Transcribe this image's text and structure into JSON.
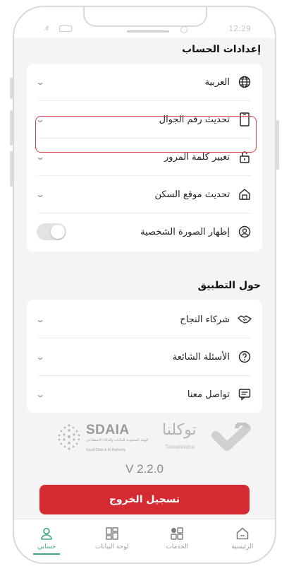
{
  "status_bar": {
    "time": "12:29"
  },
  "account_settings": {
    "title": "إعدادات الحساب",
    "items": [
      {
        "label": "العربية",
        "icon": "globe-icon"
      },
      {
        "label": "تحديث رقم الجوال",
        "icon": "mobile-phone-icon"
      },
      {
        "label": "تغيير كلمة المرور",
        "icon": "lock-icon"
      },
      {
        "label": "تحديث موقع السكن",
        "icon": "home-icon"
      },
      {
        "label": "إظهار الصورة الشخصية",
        "icon": "user-circle-icon",
        "toggle_on": false
      }
    ]
  },
  "about_app": {
    "title": "حول التطبيق",
    "items": [
      {
        "label": "شركاء النجاح",
        "icon": "handshake-icon"
      },
      {
        "label": "الأسئلة الشائعة",
        "icon": "question-icon"
      },
      {
        "label": "تواصل معنا",
        "icon": "chat-icon"
      }
    ]
  },
  "logos": {
    "sdaia_name": "SDAIA",
    "sdaia_ar": "الهيئة السعودية للبيانات والذكاء الاصطناعي",
    "sdaia_en": "Saudi Data & AI Authority",
    "tawakkalna_ar": "توكلنا",
    "tawakkalna_en": "Tawakkalna"
  },
  "version": "V 2.2.0",
  "logout_label": "تسجيل الخروج",
  "bottom_nav": [
    {
      "label": "حسابي",
      "icon": "user-icon",
      "active": true
    },
    {
      "label": "لوحة البيانات",
      "icon": "dashboard-icon",
      "active": false
    },
    {
      "label": "الخدمات",
      "icon": "services-icon",
      "active": false
    },
    {
      "label": "الرئيسية",
      "icon": "home-icon",
      "active": false
    }
  ],
  "colors": {
    "accent": "#3aa77d",
    "danger": "#d62a33",
    "highlight": "#d8424b"
  }
}
